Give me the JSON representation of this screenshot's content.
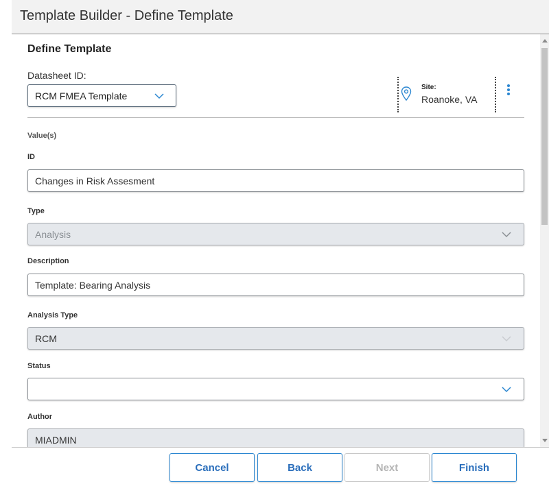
{
  "window": {
    "title": "Template Builder - Define Template"
  },
  "section": {
    "title": "Define Template"
  },
  "datasheet": {
    "label": "Datasheet ID:",
    "value": "RCM FMEA Template"
  },
  "site": {
    "label": "Site:",
    "value": "Roanoke, VA",
    "icon": "map-pin-icon"
  },
  "menu": {
    "icon": "kebab-menu-icon"
  },
  "form": {
    "values_header": "Value(s)",
    "id": {
      "label": "ID",
      "value": "Changes in Risk Assesment"
    },
    "type": {
      "label": "Type",
      "value": "Analysis"
    },
    "description": {
      "label": "Description",
      "value": "Template: Bearing Analysis"
    },
    "analysis_type": {
      "label": "Analysis Type",
      "value": "RCM"
    },
    "status": {
      "label": "Status",
      "value": ""
    },
    "author": {
      "label": "Author",
      "value": "MIADMIN"
    }
  },
  "buttons": {
    "cancel": "Cancel",
    "back": "Back",
    "next": "Next",
    "finish": "Finish"
  },
  "colors": {
    "accent": "#2a86d1",
    "disabled_field": "#e5e8ec"
  }
}
